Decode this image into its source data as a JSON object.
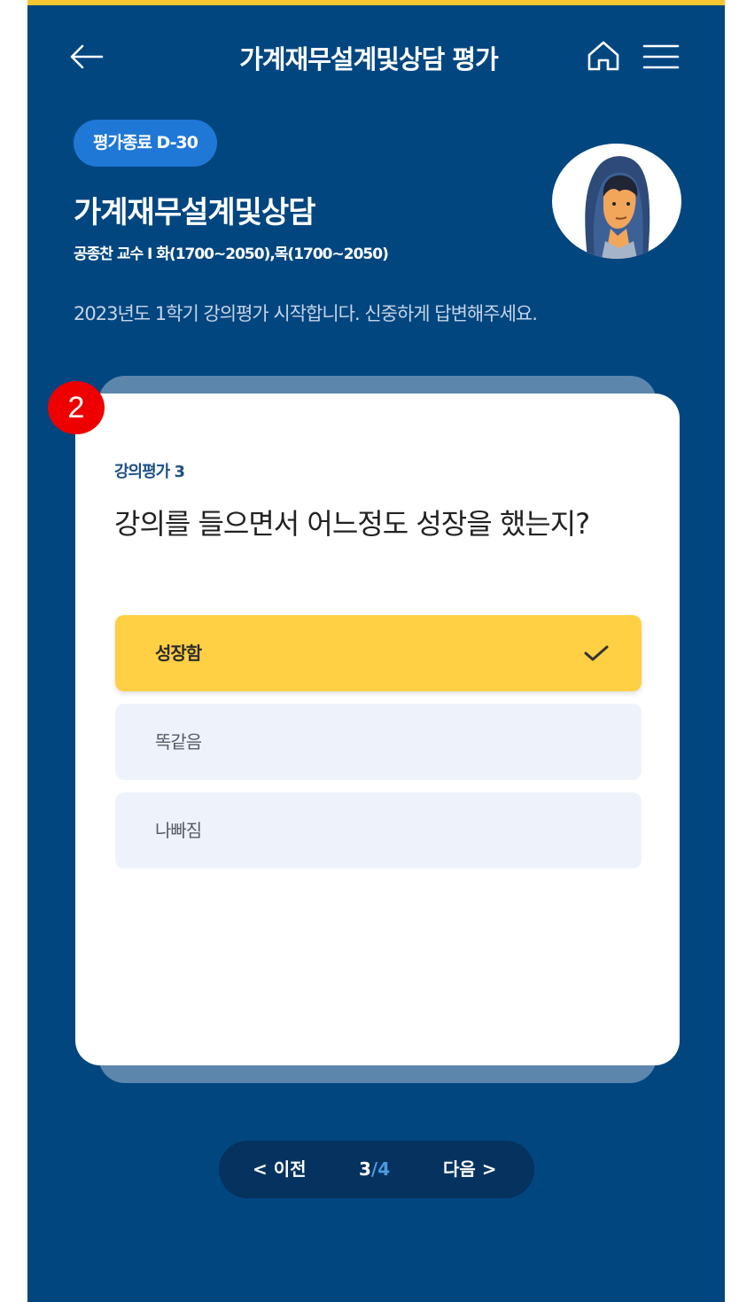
{
  "header": {
    "title": "가계재무설계및상담 평가"
  },
  "course": {
    "badge": "평가종료 D-30",
    "name": "가계재무설계및상담",
    "meta": "공종찬 교수 I 화(1700~2050),목(1700~2050)",
    "notice": "2023년도 1학기 강의평가 시작합니다. 신중하게 답변해주세요."
  },
  "step_marker": "2",
  "question": {
    "label": "강의평가 3",
    "text": "강의를 들으면서 어느정도 성장을 했는지?",
    "options": [
      {
        "label": "성장함",
        "selected": true
      },
      {
        "label": "똑같음",
        "selected": false
      },
      {
        "label": "나빠짐",
        "selected": false
      }
    ]
  },
  "pager": {
    "prev": "< 이전",
    "current": "3",
    "separator": "/",
    "total": "4",
    "next": "다음 >"
  },
  "colors": {
    "background": "#024680",
    "accent": "#ffcf44",
    "badge": "#1f78d6"
  }
}
